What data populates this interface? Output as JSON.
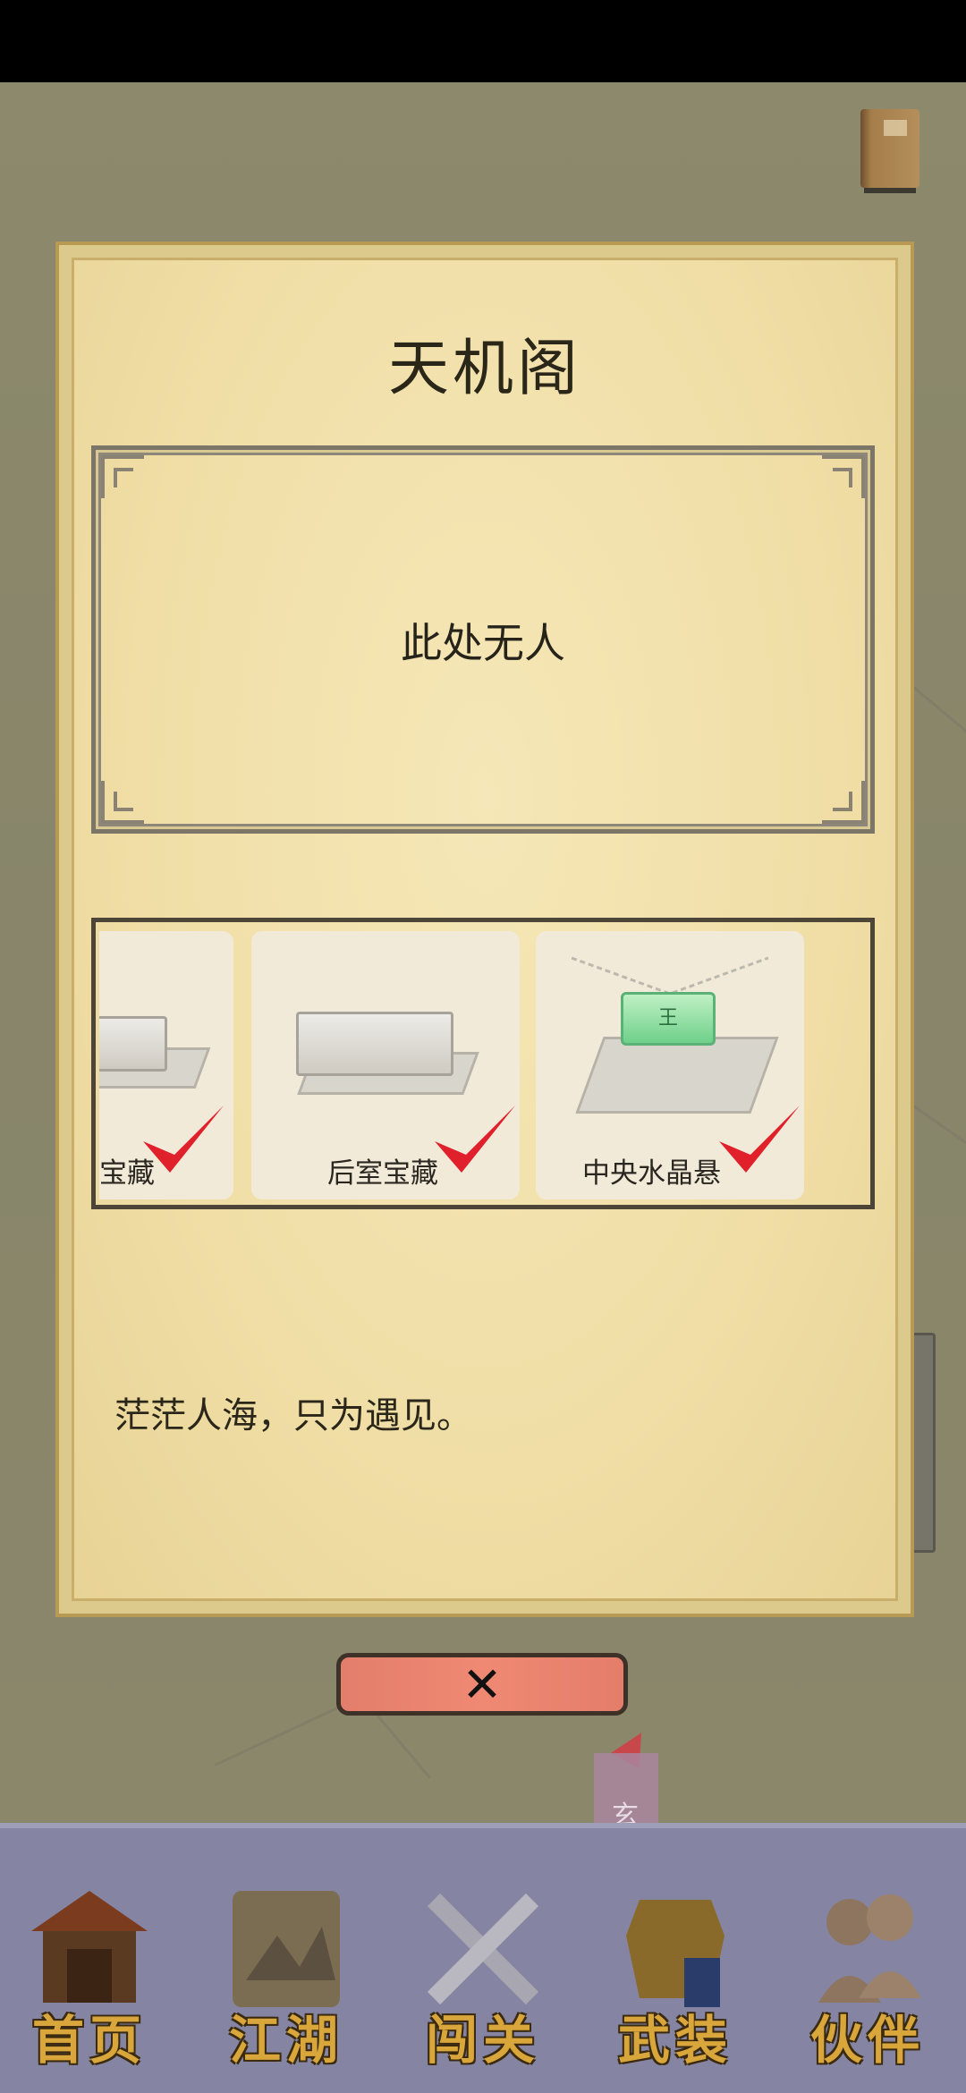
{
  "dialog": {
    "title": "天机阁",
    "portrait_empty_text": "此处无人",
    "quote": "茫茫人海，只为遇见。",
    "close_icon": "close-x-icon"
  },
  "carousel": {
    "items": [
      {
        "label": "宝藏",
        "completed": true
      },
      {
        "label": "后室宝藏",
        "completed": true
      },
      {
        "label": "中央水晶悬",
        "completed": true
      }
    ]
  },
  "scene": {
    "side_flag_char": "玄"
  },
  "bottom_nav": {
    "items": [
      {
        "label": "首页",
        "icon": "pavilion-icon"
      },
      {
        "label": "江湖",
        "icon": "scroll-map-icon"
      },
      {
        "label": "闯关",
        "icon": "crossed-swords-icon"
      },
      {
        "label": "武装",
        "icon": "armor-icon"
      },
      {
        "label": "伙伴",
        "icon": "companions-icon"
      }
    ]
  },
  "colors": {
    "close_button": "#f08973",
    "check_mark": "#e0202a",
    "nav_label": "#d9a63b",
    "nav_bg": "#8585a3"
  }
}
